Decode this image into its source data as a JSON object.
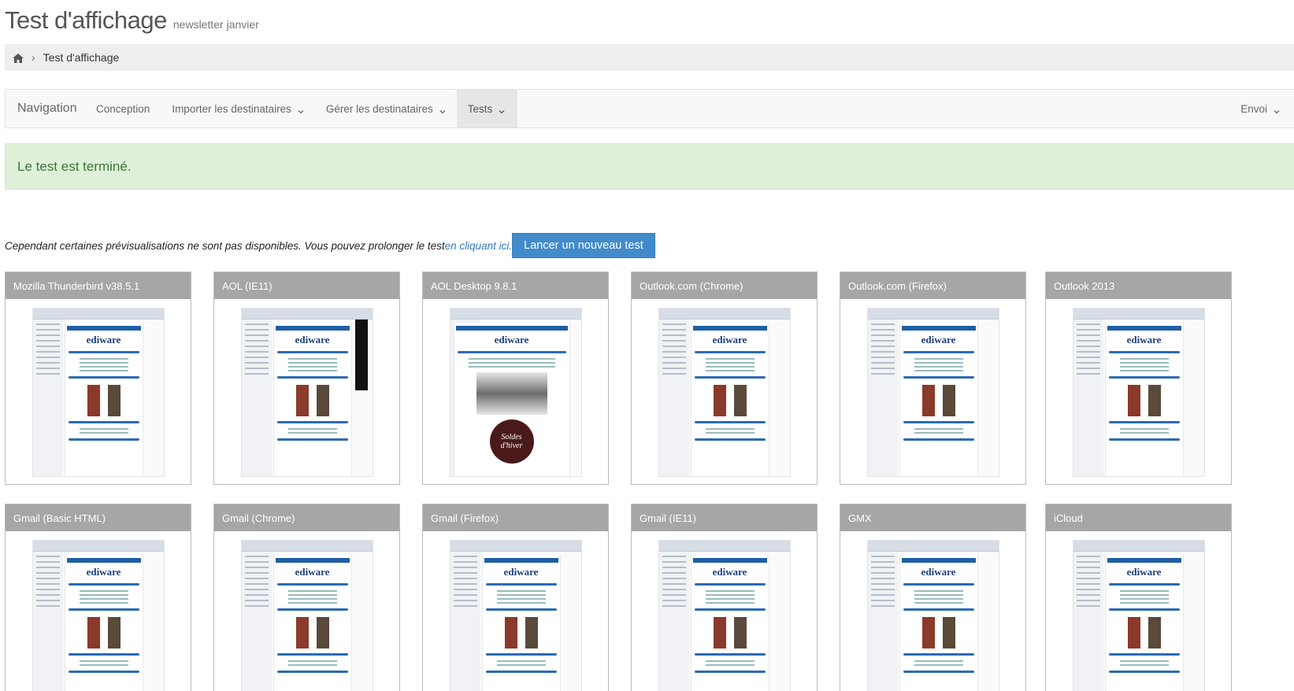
{
  "header": {
    "title": "Test d'affichage",
    "subtitle": "newsletter janvier"
  },
  "breadcrumb": {
    "home_icon": "home-icon",
    "separator": "›",
    "current": "Test d'affichage"
  },
  "navbar": {
    "brand": "Navigation",
    "items": [
      {
        "label": "Conception",
        "dropdown": false
      },
      {
        "label": "Importer les destinataires",
        "dropdown": true
      },
      {
        "label": "Gérer les destinataires",
        "dropdown": true
      },
      {
        "label": "Tests",
        "dropdown": true,
        "active": true
      }
    ],
    "right_item": {
      "label": "Envoi",
      "dropdown": true
    }
  },
  "alert": {
    "message": "Le test est terminé.",
    "color": "#dff0d8"
  },
  "info": {
    "text": "Cependant certaines prévisualisations ne sont pas disponibles. Vous pouvez prolonger le test ",
    "link": "en cliquant ici.",
    "button": "Lancer un nouveau test"
  },
  "previews": [
    {
      "client": "Mozilla Thunderbird v38.5.1"
    },
    {
      "client": "AOL (IE11)"
    },
    {
      "client": "AOL Desktop 9.8.1"
    },
    {
      "client": "Outlook.com (Chrome)"
    },
    {
      "client": "Outlook.com (Firefox)"
    },
    {
      "client": "Outlook 2013"
    },
    {
      "client": "Gmail (Basic HTML)"
    },
    {
      "client": "Gmail (Chrome)"
    },
    {
      "client": "Gmail (Firefox)"
    },
    {
      "client": "Gmail (IE11)"
    },
    {
      "client": "GMX"
    },
    {
      "client": "iCloud"
    }
  ],
  "thumbnail_logo": "ediware",
  "soldes_text": "Soldes d'hiver",
  "colors": {
    "primary": "#428bca",
    "card_header": "#a6a6a6",
    "alert_text": "#3c763d"
  }
}
